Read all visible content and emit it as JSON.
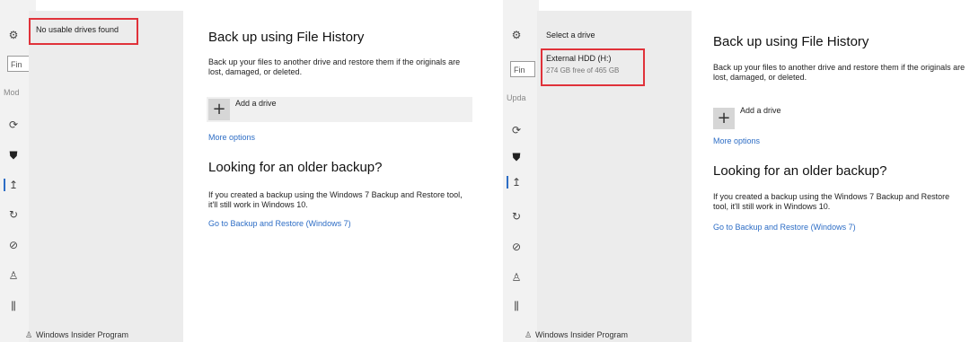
{
  "panels": [
    {
      "sidebar": {
        "search_value": "Fin",
        "section_fragment": "Mod",
        "icons": [
          "gear-icon",
          "sync-icon",
          "shield-icon",
          "backup-icon",
          "history-icon",
          "check-icon",
          "person-icon",
          "insider-bars-icon"
        ]
      },
      "popup": {
        "message": "No usable drives found"
      },
      "insider_label": "Windows Insider Program",
      "main": {
        "title": "Back up using File History",
        "description": "Back up your files to another drive and restore them if the originals are lost, damaged, or deleted.",
        "add_drive_label": "Add a drive",
        "more_options_label": "More options",
        "older_title": "Looking for an older backup?",
        "older_description": "If you created a backup using the Windows 7 Backup and Restore tool, it'll still work in Windows 10.",
        "restore_link_label": "Go to Backup and Restore (Windows 7)"
      }
    },
    {
      "sidebar": {
        "search_value": "Fin",
        "section_fragment": "Upda",
        "icons": [
          "gear-icon",
          "sync-icon",
          "shield-icon",
          "backup-icon",
          "history-icon",
          "check-icon",
          "person-icon",
          "insider-bars-icon"
        ]
      },
      "popup": {
        "header": "Select a drive",
        "drive_name": "External HDD (H:)",
        "drive_space": "274 GB free of 465 GB"
      },
      "insider_label": "Windows Insider Program",
      "main": {
        "title": "Back up using File History",
        "description": "Back up your files to another drive and restore them if the originals are lost, damaged, or deleted.",
        "add_drive_label": "Add a drive",
        "more_options_label": "More options",
        "older_title": "Looking for an older backup?",
        "older_description": "If you created a backup using the Windows 7 Backup and Restore tool, it'll still work in Windows 10.",
        "restore_link_label": "Go to Backup and Restore (Windows 7)"
      }
    }
  ],
  "colors": {
    "accent": "#2d6dc5",
    "highlight_border": "#e0323a",
    "sidebar_bg": "#f2f2f2",
    "popup_bg": "#ececec"
  }
}
